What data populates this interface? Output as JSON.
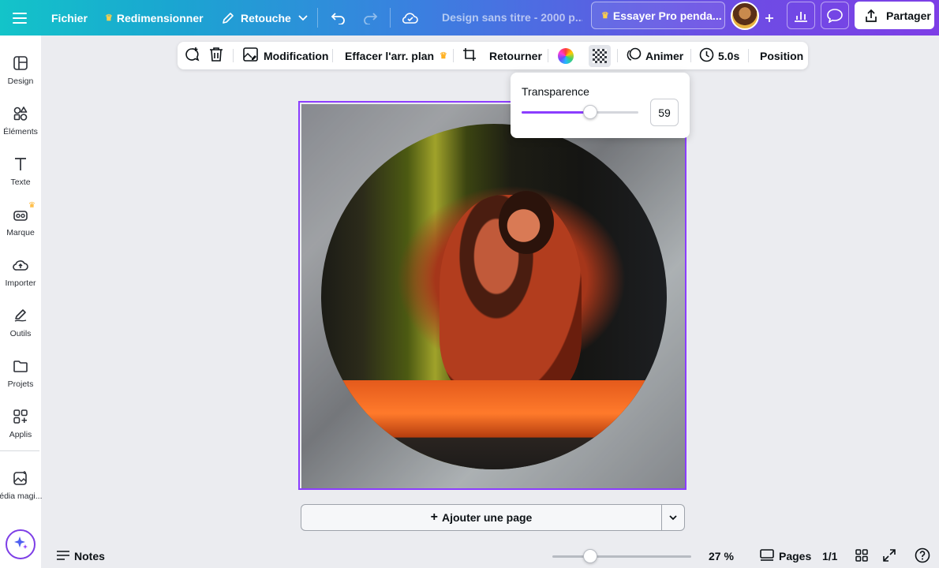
{
  "topbar": {
    "file_label": "Fichier",
    "resize_label": "Redimensionner",
    "retouch_label": "Retouche",
    "title_placeholder": "Design sans titre - 2000 p...",
    "pro_label": "Essayer Pro penda...",
    "share_label": "Partager"
  },
  "sidebar": {
    "items": [
      {
        "label": "Design",
        "icon": "layout-icon"
      },
      {
        "label": "Éléments",
        "icon": "shapes-icon"
      },
      {
        "label": "Texte",
        "icon": "text-icon"
      },
      {
        "label": "Marque",
        "icon": "brand-icon"
      },
      {
        "label": "Importer",
        "icon": "cloud-upload-icon"
      },
      {
        "label": "Outils",
        "icon": "pen-icon"
      },
      {
        "label": "Projets",
        "icon": "folder-icon"
      },
      {
        "label": "Applis",
        "icon": "apps-icon"
      },
      {
        "label": "Média magi...",
        "icon": "magic-media-icon"
      }
    ]
  },
  "toolbar": {
    "edit_label": "Modification",
    "bg_remove_label": "Effacer l'arr. plan",
    "flip_label": "Retourner",
    "animate_label": "Animer",
    "duration_label": "5.0s",
    "position_label": "Position"
  },
  "transparency_popup": {
    "title": "Transparence",
    "value": "59",
    "fraction": 0.59
  },
  "canvas": {
    "add_page_label": "Ajouter une page"
  },
  "bottombar": {
    "notes_label": "Notes",
    "zoom_label": "27 %",
    "zoom_fraction": 0.27,
    "pages_label": "Pages",
    "page_count": "1/1"
  },
  "colors": {
    "accent": "#8b3dff",
    "gradient_start": "#13c4c9",
    "gradient_end": "#7d3ee6",
    "crown": "#ffcf4a"
  }
}
